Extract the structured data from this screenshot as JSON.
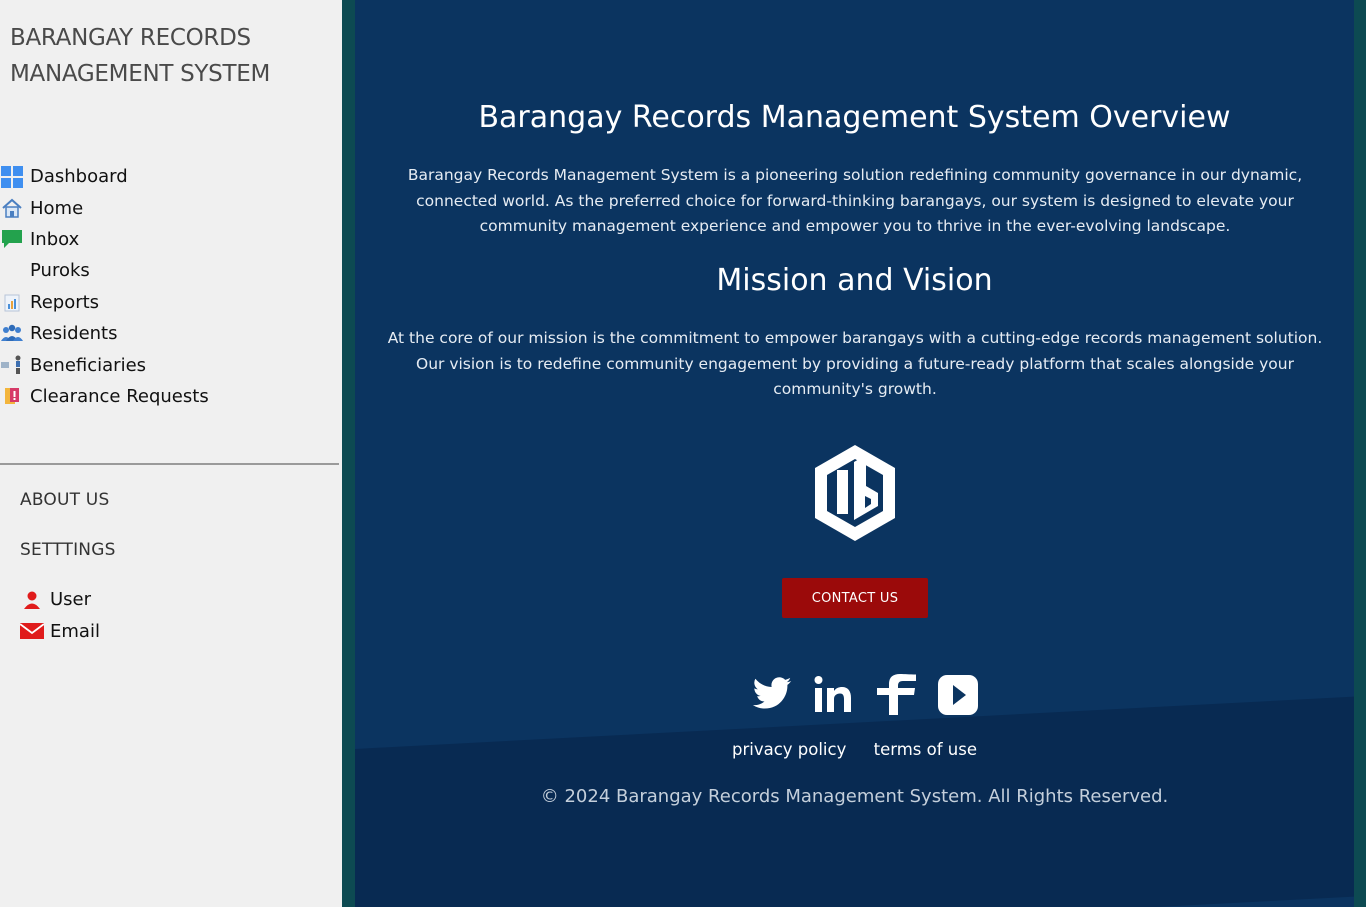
{
  "sidebar": {
    "brand_line1": "BARANGAY RECORDS",
    "brand_line2": "MANAGEMENT SYSTEM",
    "nav": [
      {
        "label": "Dashboard",
        "icon": "dashboard-grid-icon"
      },
      {
        "label": "Home",
        "icon": "home-icon"
      },
      {
        "label": "Inbox",
        "icon": "chat-icon"
      },
      {
        "label": "Puroks",
        "icon": ""
      },
      {
        "label": "Reports",
        "icon": "reports-chart-icon"
      },
      {
        "label": "Residents",
        "icon": "residents-group-icon"
      },
      {
        "label": "Beneficiaries",
        "icon": "beneficiaries-icon"
      },
      {
        "label": "Clearance Requests",
        "icon": "clearance-request-icon"
      }
    ],
    "about_label": "ABOUT US",
    "settings_label": "SETTTINGS",
    "settings_items": [
      {
        "label": "User",
        "icon": "user-icon"
      },
      {
        "label": "Email",
        "icon": "email-icon"
      }
    ]
  },
  "main": {
    "overview_title": "Barangay Records Management System Overview",
    "overview_text": "Barangay Records Management System is a pioneering solution redefining community governance in our dynamic, connected world. As the preferred choice for forward-thinking barangays, our system is designed to elevate your community management experience and empower you to thrive in the ever-evolving landscape.",
    "mission_title": "Mission and Vision",
    "mission_text": "At the core of our mission is the commitment to empower barangays with a cutting-edge records management solution. Our vision is to redefine community engagement by providing a future-ready platform that scales alongside your community's growth.",
    "contact_label": "CONTACT US",
    "privacy_label": "privacy policy",
    "terms_label": "terms of use",
    "copyright": "© 2024 Barangay Records Management System. All Rights Reserved."
  },
  "colors": {
    "main_bg": "#0b3460",
    "contact_button": "#9b0a0a",
    "frame": "#0d4a52",
    "sidebar_bg": "#f0f0f0"
  }
}
